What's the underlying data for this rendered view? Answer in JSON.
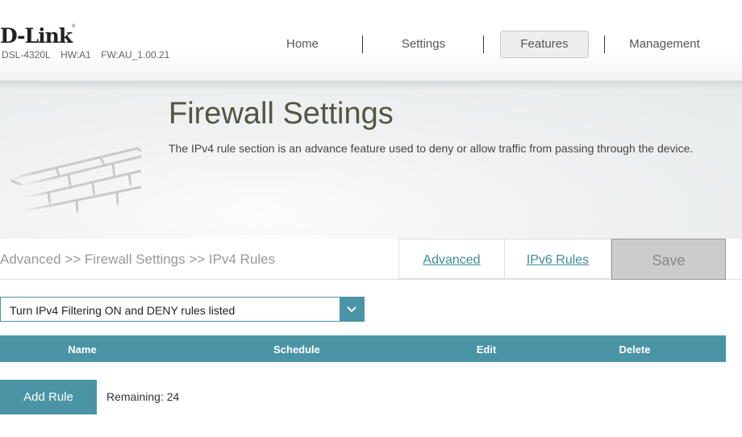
{
  "brand": {
    "logo": "D-Link",
    "registered_mark": "®",
    "model": "DSL-4320L",
    "hardware": "HW:A1",
    "firmware": "FW:AU_1.00.21"
  },
  "nav": {
    "items": [
      {
        "label": "Home",
        "active": false
      },
      {
        "label": "Settings",
        "active": false
      },
      {
        "label": "Features",
        "active": true
      },
      {
        "label": "Management",
        "active": false
      }
    ]
  },
  "banner": {
    "icon": "brick-wall-icon",
    "title": "Firewall Settings",
    "description": "The IPv4 rule section is an advance feature used to deny or allow traffic from passing through the device."
  },
  "breadcrumb": {
    "text": "Advanced >> Firewall Settings >> IPv4 Rules"
  },
  "actions": {
    "advanced_label": "Advanced",
    "ipv6_label": "IPv6 Rules",
    "save_label": "Save"
  },
  "filter": {
    "selected": "Turn IPv4 Filtering ON and DENY rules listed",
    "arrow_icon": "chevron-down-icon"
  },
  "table": {
    "columns": [
      "Name",
      "Schedule",
      "Edit",
      "Delete"
    ],
    "rows": []
  },
  "footer": {
    "add_rule_label": "Add Rule",
    "remaining_text": "Remaining: 24"
  },
  "colors": {
    "accent": "#4a94a6",
    "link": "#3e8a9a",
    "save_bg": "#cccccc",
    "title": "#545445"
  }
}
